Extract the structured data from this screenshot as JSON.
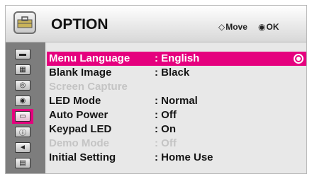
{
  "header": {
    "title": "OPTION",
    "icon": "option-toolbox-icon",
    "hints": [
      {
        "symbol": "◇",
        "label": "Move",
        "icon": "navigate-arrows-icon"
      },
      {
        "symbol": "◉",
        "label": "OK",
        "icon": "ok-button-icon"
      }
    ]
  },
  "sidebar": {
    "tabs": [
      {
        "icon": "picture-icon",
        "glyph": "▬",
        "active": false
      },
      {
        "icon": "audio-icon",
        "glyph": "▦",
        "active": false
      },
      {
        "icon": "time-icon",
        "glyph": "◎",
        "active": false
      },
      {
        "icon": "lock-icon",
        "glyph": "◉",
        "active": false
      },
      {
        "icon": "option-icon",
        "glyph": "▭",
        "active": true
      },
      {
        "icon": "info-icon",
        "glyph": "ⓘ",
        "active": false
      },
      {
        "icon": "input-icon",
        "glyph": "◄",
        "active": false
      },
      {
        "icon": "usb-icon",
        "glyph": "▤",
        "active": false
      }
    ]
  },
  "menu": {
    "items": [
      {
        "label": "Menu Language",
        "value": ": English",
        "state": "selected"
      },
      {
        "label": "Blank Image",
        "value": ": Black",
        "state": "normal"
      },
      {
        "label": "Screen Capture",
        "value": "",
        "state": "disabled"
      },
      {
        "label": "LED Mode",
        "value": ": Normal",
        "state": "normal"
      },
      {
        "label": "Auto Power",
        "value": ": Off",
        "state": "normal"
      },
      {
        "label": "Keypad LED",
        "value": ": On",
        "state": "normal"
      },
      {
        "label": "Demo Mode",
        "value": ": Off",
        "state": "disabled"
      },
      {
        "label": "Initial Setting",
        "value": ": Home Use",
        "state": "normal"
      }
    ]
  },
  "colors": {
    "accent": "#e5007e",
    "panel": "#e8e8e8",
    "sidebar": "#7d7d7d",
    "disabled_text": "#c4c4c4"
  }
}
